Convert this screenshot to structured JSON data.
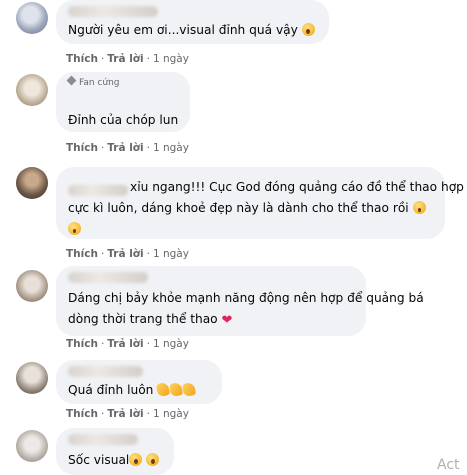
{
  "actions": {
    "like": "Thích",
    "reply": "Trả lời",
    "separator": "·"
  },
  "comments": [
    {
      "badge": "",
      "lines": [
        "Người yêu em ơi...visual đỉnh quá vậy"
      ],
      "emojis_end": [
        "wow"
      ],
      "time": "1 ngày"
    },
    {
      "badge": "Fan cứng",
      "lines": [
        "Đỉnh của chóp lun"
      ],
      "emojis_end": [],
      "time": "1 ngày"
    },
    {
      "badge": "",
      "lines": [
        "xỉu ngang!!! Cục God đóng quảng cáo đồ thể thao hợp",
        "cực kì luôn, dáng khoẻ đẹp này là dành cho thể thao rồi"
      ],
      "emojis_end": [
        "scream",
        "scream"
      ],
      "time": "1 ngày"
    },
    {
      "badge": "",
      "lines": [
        "Dáng chị bảy khỏe mạnh năng động nên hợp để quảng bá",
        "dòng thời trang thể thao"
      ],
      "emojis_end": [
        "heart"
      ],
      "time": "1 ngày"
    },
    {
      "badge": "",
      "lines": [
        "Quá đỉnh luôn"
      ],
      "emojis_end": [
        "clap",
        "clap",
        "clap"
      ],
      "time": "1 ngày"
    },
    {
      "badge": "",
      "lines": [
        "Sốc visual"
      ],
      "emojis_end": [
        "wow",
        "wow"
      ],
      "time": ""
    }
  ],
  "watermark": "Act"
}
